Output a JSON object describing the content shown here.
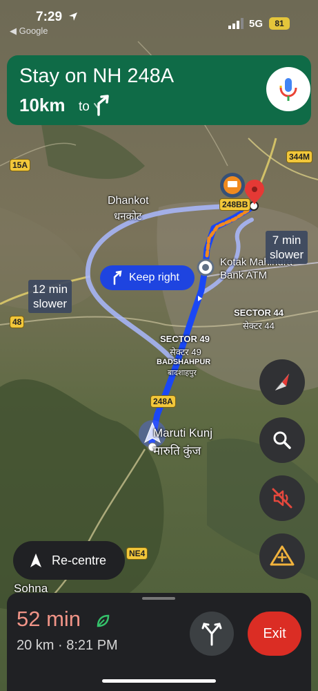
{
  "status_bar": {
    "time": "7:29",
    "back_app": "◀ Google",
    "network": "5G",
    "battery": "81"
  },
  "banner": {
    "instruction": "Stay on NH 248A",
    "distance": "10km",
    "to_label": "to"
  },
  "map": {
    "places": [
      {
        "name": "Dhankot"
      },
      {
        "name": "धनकोट"
      },
      {
        "name": "Kotak Mahindra"
      },
      {
        "name": "Bank ATM"
      },
      {
        "name": "SECTOR 44"
      },
      {
        "name": "सेक्टर 44"
      },
      {
        "name": "SECTOR 49"
      },
      {
        "name": "सेक्टर 49"
      },
      {
        "name": "BADSHAHPUR"
      },
      {
        "name": "बादशाहपुर"
      },
      {
        "name": "Maruti Kunj"
      },
      {
        "name": "मारुति कुंज"
      },
      {
        "name": "Sohna"
      }
    ],
    "shields": [
      "344M",
      "248BB",
      "15A",
      "48",
      "248A",
      "NE4"
    ],
    "alt_routes": [
      {
        "time": "12 min",
        "note": "slower"
      },
      {
        "time": "7 min",
        "note": "slower"
      }
    ],
    "maneuver_chip": "Keep right"
  },
  "buttons": {
    "recentre": "Re-centre",
    "exit": "Exit"
  },
  "trip": {
    "eta_minutes": "52 min",
    "distance_time": "20 km · 8:21 PM"
  },
  "colors": {
    "banner": "#0f6b47",
    "route": "#1a47f5",
    "alt_route": "#a9b8ff",
    "traffic": "#f08a1f",
    "exit": "#db2d24",
    "eta": "#f19487"
  }
}
